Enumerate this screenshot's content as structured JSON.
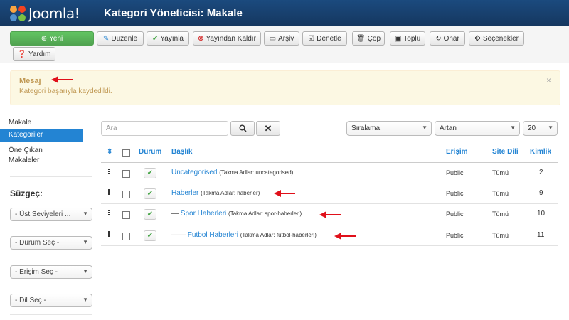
{
  "header": {
    "logo_text": "Joomla!",
    "title": "Kategori Yöneticisi: Makale"
  },
  "toolbar": {
    "new": "Yeni",
    "edit": "Düzenle",
    "publish": "Yayınla",
    "unpublish": "Yayından Kaldır",
    "archive": "Arşiv",
    "checkin": "Denetle",
    "trash": "Çöp",
    "batch": "Toplu",
    "rebuild": "Onar",
    "options": "Seçenekler",
    "help": "Yardım"
  },
  "message": {
    "title": "Mesaj",
    "text": "Kategori başarıyla kaydedildi.",
    "close": "×"
  },
  "sidebar": {
    "items": [
      {
        "label": "Makale"
      },
      {
        "label": "Kategoriler"
      },
      {
        "label": "Öne Çıkan Makaleler"
      }
    ],
    "filter_title": "Süzgeç:",
    "filters": [
      "- Üst Seviyeleri ...",
      "- Durum Seç -",
      "- Erişim Seç -",
      "- Dil Seç -"
    ]
  },
  "search": {
    "placeholder": "Ara"
  },
  "sort": {
    "ordering": "Sıralama",
    "direction": "Artan",
    "limit": "20"
  },
  "table": {
    "headers": {
      "sort": "⇕",
      "status": "Durum",
      "title": "Başlık",
      "access": "Erişim",
      "language": "Site Dili",
      "id": "Kimlik"
    },
    "rows": [
      {
        "prefix": "",
        "title": "Uncategorised",
        "alias": "(Takma Adlar: uncategorised)",
        "access": "Public",
        "language": "Tümü",
        "id": "2"
      },
      {
        "prefix": "",
        "title": "Haberler",
        "alias": "(Takma Adlar: haberler)",
        "access": "Public",
        "language": "Tümü",
        "id": "9"
      },
      {
        "prefix": "—",
        "title": "Spor Haberleri",
        "alias": "(Takma Adlar: spor-haberleri)",
        "access": "Public",
        "language": "Tümü",
        "id": "10"
      },
      {
        "prefix": "——",
        "title": "Futbol Haberleri",
        "alias": "(Takma Adlar: futbol-haberleri)",
        "access": "Public",
        "language": "Tümü",
        "id": "11"
      }
    ]
  },
  "colors": {
    "primary": "#2384d3",
    "header": "#1b4a7e",
    "success": "#51a351",
    "annotation": "#e0101a"
  }
}
